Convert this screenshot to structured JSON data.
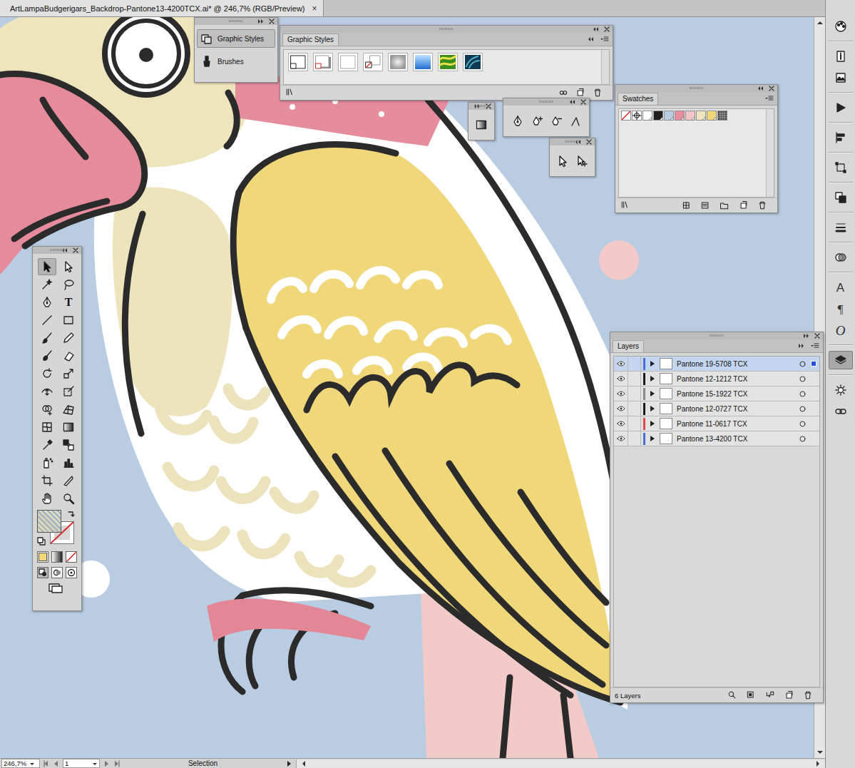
{
  "document_tab": {
    "title": "ArtLampaBudgerigars_Backdrop-Pantone13-4200TCX.ai* @ 246,7% (RGB/Preview)",
    "close": "×"
  },
  "dock": {
    "items": [
      {
        "label": "Graphic Styles",
        "selected": true
      },
      {
        "label": "Brushes",
        "selected": false
      }
    ]
  },
  "graphic_styles": {
    "title": "Graphic Styles",
    "styles": [
      {
        "kind": "default",
        "selected": false
      },
      {
        "kind": "shadow",
        "selected": false
      },
      {
        "kind": "plain",
        "selected": false
      },
      {
        "kind": "no-fill",
        "selected": false
      },
      {
        "kind": "grey-gradient",
        "selected": false
      },
      {
        "kind": "blue-gradient",
        "selected": false
      },
      {
        "kind": "green-pattern",
        "selected": false
      },
      {
        "kind": "teal-pattern",
        "selected": false
      }
    ]
  },
  "swatches": {
    "title": "Swatches",
    "items": [
      {
        "kind": "none",
        "selected": false
      },
      {
        "kind": "registration",
        "selected": false
      },
      {
        "kind": "color",
        "color": "#ffffff",
        "selected": false
      },
      {
        "kind": "color",
        "color": "#231f20",
        "selected": false
      },
      {
        "kind": "color",
        "color": "#b8cce2",
        "selected": false
      },
      {
        "kind": "color",
        "color": "#e58c9d",
        "selected": false
      },
      {
        "kind": "color",
        "color": "#f2c6c6",
        "selected": false
      },
      {
        "kind": "color",
        "color": "#efe5bd",
        "selected": false
      },
      {
        "kind": "color",
        "color": "#f0d77a",
        "selected": false
      },
      {
        "kind": "pattern",
        "selected": false
      }
    ]
  },
  "gradient_tools": [
    {
      "kind": "gradient",
      "selected": false
    }
  ],
  "pen_tools": [
    {
      "kind": "pen",
      "selected": false
    },
    {
      "kind": "add-anchor",
      "selected": false
    },
    {
      "kind": "delete-anchor",
      "selected": false
    },
    {
      "kind": "convert-anchor",
      "selected": false
    }
  ],
  "selection_tools": [
    {
      "kind": "direct-selection",
      "selected": false
    },
    {
      "kind": "group-selection",
      "selected": false
    }
  ],
  "layers": {
    "title": "Layers",
    "count": "6 Layers",
    "rows": [
      {
        "name": "Pantone 19-5708 TCX",
        "visible": true,
        "expanded": false,
        "selected": true,
        "color": "#4a6ee0"
      },
      {
        "name": "Pantone 12-1212 TCX",
        "visible": true,
        "expanded": false,
        "selected": false,
        "color": "#1a1a1a"
      },
      {
        "name": "Pantone 15-1922 TCX",
        "visible": true,
        "expanded": false,
        "selected": false,
        "color": "#8a8a8a"
      },
      {
        "name": "Pantone 12-0727 TCX",
        "visible": true,
        "expanded": false,
        "selected": false,
        "color": "#1a1a1a"
      },
      {
        "name": "Pantone 11-0617 TCX",
        "visible": true,
        "expanded": false,
        "selected": false,
        "color": "#e04848"
      },
      {
        "name": "Pantone 13-4200 TCX",
        "visible": true,
        "expanded": false,
        "selected": false,
        "color": "#4a6ee0"
      }
    ]
  },
  "tools": [
    {
      "kind": "selection",
      "selected": true
    },
    {
      "kind": "direct-selection",
      "selected": false
    },
    {
      "kind": "magic-wand",
      "selected": false
    },
    {
      "kind": "lasso",
      "selected": false
    },
    {
      "kind": "pen",
      "selected": false
    },
    {
      "kind": "type",
      "text": "T",
      "selected": false
    },
    {
      "kind": "line",
      "selected": false
    },
    {
      "kind": "rectangle",
      "selected": false
    },
    {
      "kind": "paintbrush",
      "selected": false
    },
    {
      "kind": "pencil",
      "selected": false
    },
    {
      "kind": "blob-brush",
      "selected": false
    },
    {
      "kind": "eraser",
      "selected": false
    },
    {
      "kind": "rotate",
      "selected": false
    },
    {
      "kind": "scale",
      "selected": false
    },
    {
      "kind": "width",
      "selected": false
    },
    {
      "kind": "free-transform",
      "selected": false
    },
    {
      "kind": "shape-builder",
      "selected": false
    },
    {
      "kind": "perspective",
      "selected": false
    },
    {
      "kind": "mesh",
      "selected": false
    },
    {
      "kind": "gradient",
      "selected": false
    },
    {
      "kind": "eyedropper",
      "selected": false
    },
    {
      "kind": "blend",
      "selected": false
    },
    {
      "kind": "symbol-sprayer",
      "selected": false
    },
    {
      "kind": "graph",
      "selected": false
    },
    {
      "kind": "artboard",
      "selected": false
    },
    {
      "kind": "slice",
      "selected": false
    },
    {
      "kind": "hand",
      "selected": false
    },
    {
      "kind": "zoom",
      "selected": false
    }
  ],
  "right_toolbar": [
    {
      "kind": "color",
      "selected": false
    },
    {
      "kind": "info",
      "selected": false
    },
    {
      "kind": "image",
      "selected": false
    },
    {
      "kind": "actions",
      "selected": false
    },
    {
      "kind": "align",
      "selected": false
    },
    {
      "kind": "transform",
      "selected": false
    },
    {
      "kind": "pathfinder",
      "selected": false
    },
    {
      "kind": "stroke",
      "selected": false
    },
    {
      "kind": "transparency",
      "selected": false
    },
    {
      "kind": "character",
      "text": "A",
      "selected": false
    },
    {
      "kind": "paragraph",
      "text": "¶",
      "selected": false
    },
    {
      "kind": "opentype",
      "text": "O",
      "selected": false
    },
    {
      "kind": "layers",
      "selected": true
    },
    {
      "kind": "appearance",
      "selected": false
    },
    {
      "kind": "links",
      "selected": false
    }
  ],
  "status_bar": {
    "zoom": "246,7%",
    "page": "1",
    "tool": "Selection"
  }
}
